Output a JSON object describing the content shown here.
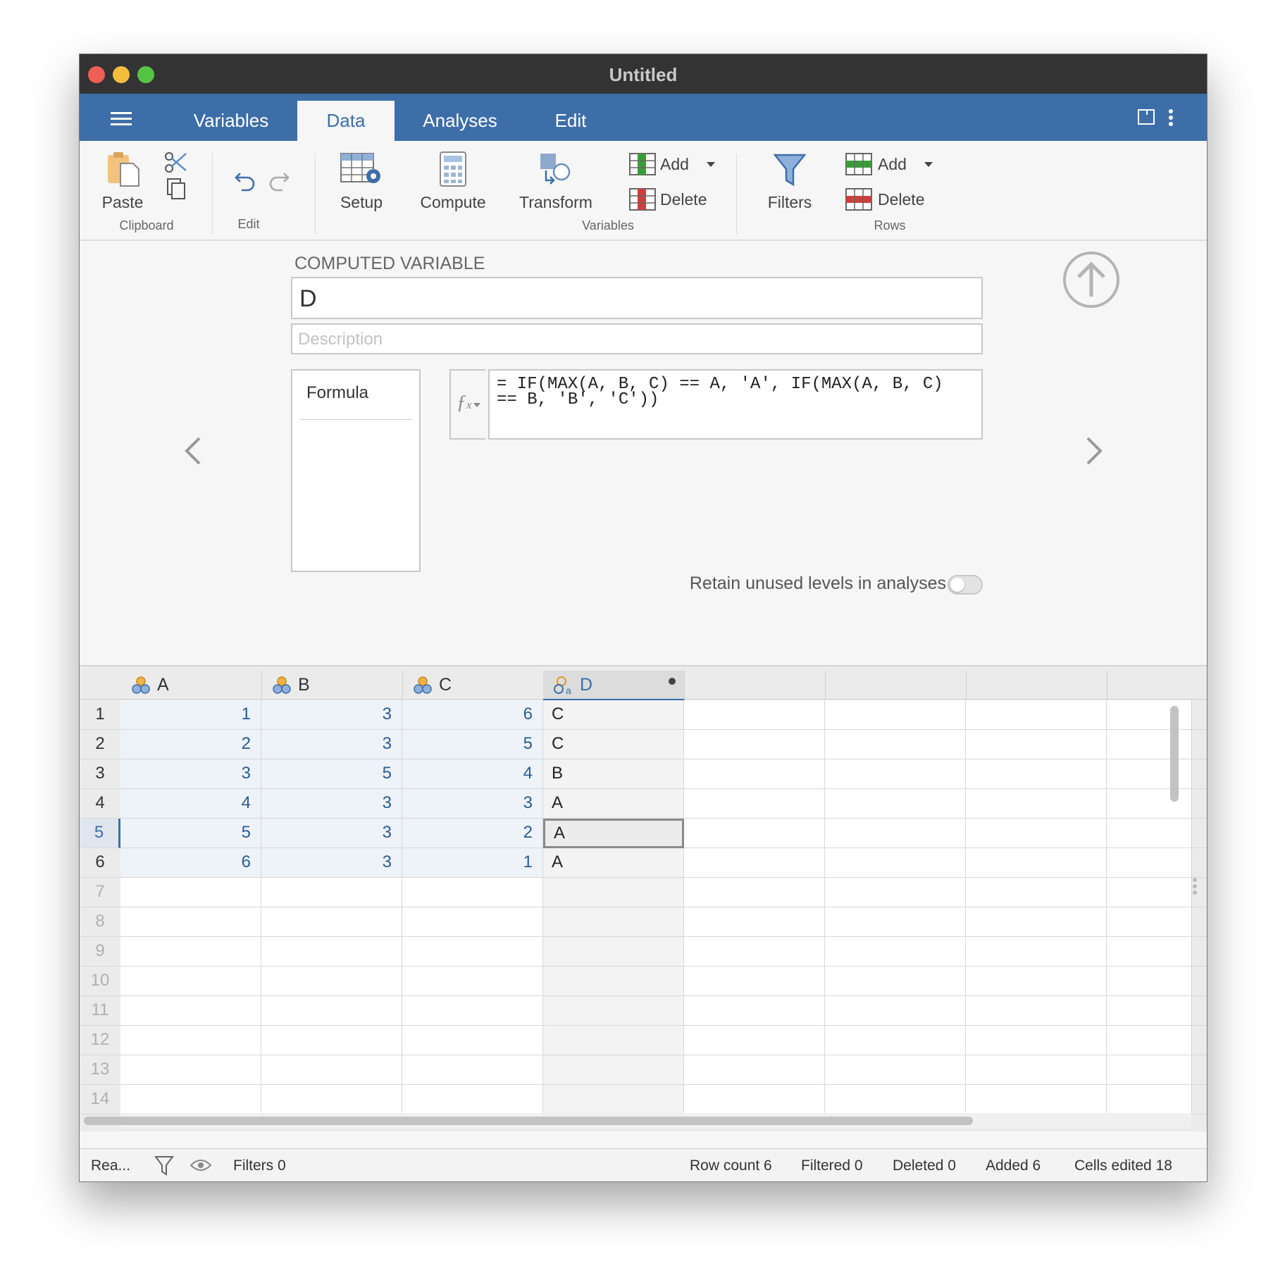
{
  "window": {
    "title": "Untitled"
  },
  "menu": {
    "tabs": [
      "Variables",
      "Data",
      "Analyses",
      "Edit"
    ],
    "active_tab": "Data"
  },
  "toolbar": {
    "paste": "Paste",
    "clipboard_group": "Clipboard",
    "edit_group": "Edit",
    "setup": "Setup",
    "compute": "Compute",
    "transform": "Transform",
    "var_add": "Add",
    "var_delete": "Delete",
    "variables_group": "Variables",
    "filters": "Filters",
    "row_add": "Add",
    "row_delete": "Delete",
    "rows_group": "Rows"
  },
  "computed": {
    "heading": "COMPUTED VARIABLE",
    "name": "D",
    "description_placeholder": "Description",
    "formula_label": "Formula",
    "formula_line1": "= IF(MAX(A, B, C) == A, 'A', IF(MAX(A, B, C)",
    "formula_line2": "== B, 'B', 'C'))",
    "retain_label": "Retain unused levels in analyses"
  },
  "grid": {
    "columns": [
      "A",
      "B",
      "C",
      "D"
    ],
    "rows": [
      [
        "1",
        "3",
        "6",
        "C"
      ],
      [
        "2",
        "3",
        "5",
        "C"
      ],
      [
        "3",
        "5",
        "4",
        "B"
      ],
      [
        "4",
        "3",
        "3",
        "A"
      ],
      [
        "5",
        "3",
        "2",
        "A"
      ],
      [
        "6",
        "3",
        "1",
        "A"
      ]
    ],
    "row_numbers": [
      "1",
      "2",
      "3",
      "4",
      "5",
      "6",
      "7",
      "8",
      "9",
      "10",
      "11",
      "12",
      "13",
      "14"
    ],
    "selected_row": 5
  },
  "status": {
    "ready": "Rea...",
    "filters": "Filters 0",
    "row_count": "Row count 6",
    "filtered": "Filtered 0",
    "deleted": "Deleted 0",
    "added": "Added 6",
    "cells_edited": "Cells edited 18"
  },
  "colors": {
    "accent": "#3e6ea8",
    "number_text": "#2c5a94",
    "filled_cell": "#eef3f9"
  }
}
